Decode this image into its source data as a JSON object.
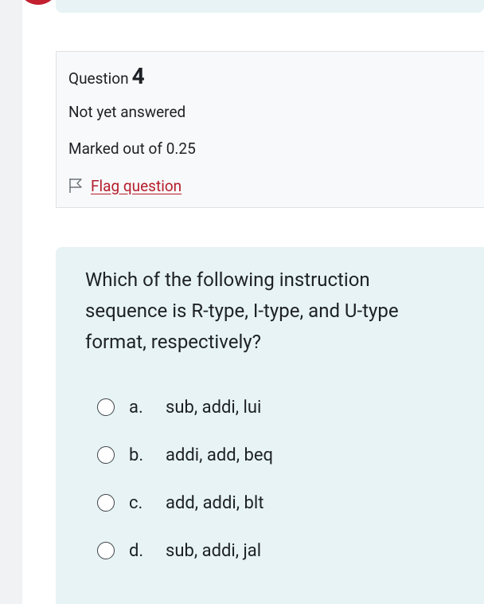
{
  "question": {
    "label": "Question",
    "number": "4",
    "state": "Not yet answered",
    "grade": "Marked out of 0.25",
    "flag_label": "Flag question",
    "text": "Which of the following instruction sequence is R-type, I-type, and U-type format, respectively?"
  },
  "answers": [
    {
      "letter": "a.",
      "text": "sub, addi, lui",
      "selected": false
    },
    {
      "letter": "b.",
      "text": "addi, add, beq",
      "selected": false
    },
    {
      "letter": "c.",
      "text": "add, addi, blt",
      "selected": false
    },
    {
      "letter": "d.",
      "text": "sub, addi, jal",
      "selected": false
    }
  ],
  "colors": {
    "accent": "#c3202f",
    "link": "#b51d2b",
    "content_bg": "#e7f3f5",
    "info_bg": "#f8f9fa"
  },
  "icons": {
    "flag": "flag-outline-icon"
  }
}
